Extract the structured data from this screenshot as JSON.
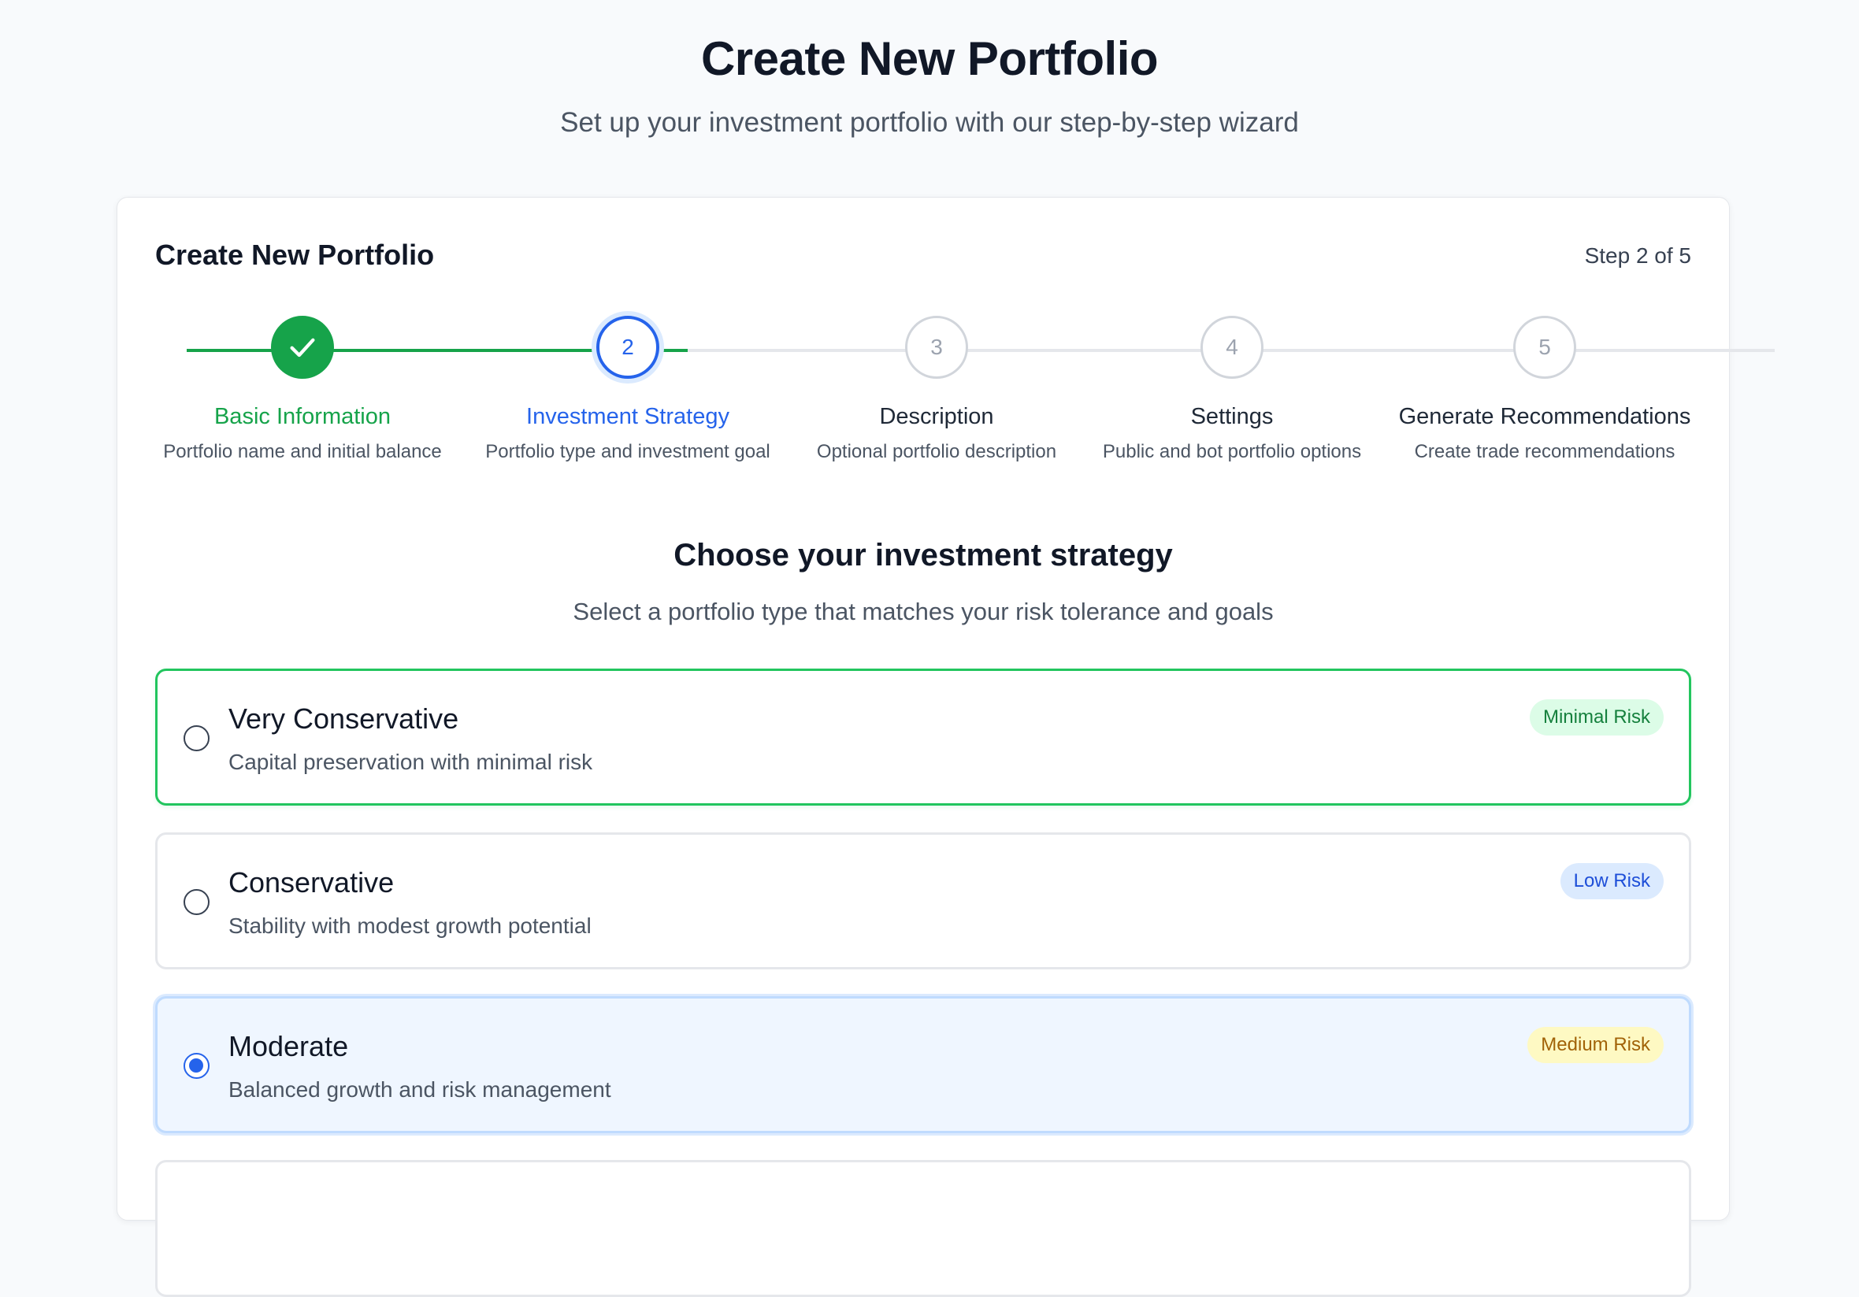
{
  "header": {
    "title": "Create New Portfolio",
    "subtitle": "Set up your investment portfolio with our step-by-step wizard"
  },
  "card": {
    "title": "Create New Portfolio",
    "step_counter": "Step 2 of 5"
  },
  "steps": [
    {
      "number": "1",
      "label": "Basic Information",
      "description": "Portfolio name and initial balance",
      "status": "completed"
    },
    {
      "number": "2",
      "label": "Investment Strategy",
      "description": "Portfolio type and investment goal",
      "status": "active"
    },
    {
      "number": "3",
      "label": "Description",
      "description": "Optional portfolio description",
      "status": "pending"
    },
    {
      "number": "4",
      "label": "Settings",
      "description": "Public and bot portfolio options",
      "status": "pending"
    },
    {
      "number": "5",
      "label": "Generate Recommendations",
      "description": "Create trade recommendations",
      "status": "pending"
    }
  ],
  "strategy": {
    "title": "Choose your investment strategy",
    "subtitle": "Select a portfolio type that matches your risk tolerance and goals",
    "options": [
      {
        "name": "Very Conservative",
        "description": "Capital preservation with minimal risk",
        "badge": "Minimal Risk",
        "badge_bg": "#dcfce7",
        "badge_fg": "#15803d",
        "checked": false
      },
      {
        "name": "Conservative",
        "description": "Stability with modest growth potential",
        "badge": "Low Risk",
        "badge_bg": "#dbeafe",
        "badge_fg": "#1d4ed8",
        "checked": false
      },
      {
        "name": "Moderate",
        "description": "Balanced growth and risk management",
        "badge": "Medium Risk",
        "badge_bg": "#fef9c3",
        "badge_fg": "#a16207",
        "checked": true
      }
    ]
  },
  "colors": {
    "completed": "#16a34a",
    "active": "#2563eb",
    "pending": "#d1d5db"
  }
}
